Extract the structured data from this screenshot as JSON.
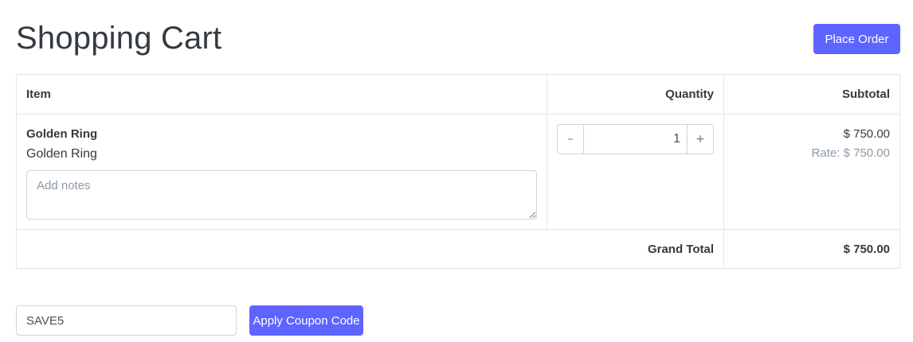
{
  "header": {
    "title": "Shopping Cart",
    "place_order_label": "Place Order"
  },
  "table": {
    "columns": {
      "item": "Item",
      "quantity": "Quantity",
      "subtotal": "Subtotal"
    },
    "items": [
      {
        "title": "Golden Ring",
        "description": "Golden Ring",
        "notes_placeholder": "Add notes",
        "notes_value": "",
        "quantity": "1",
        "decrement_glyph": "–",
        "increment_glyph": "+",
        "subtotal": "$ 750.00",
        "rate": "Rate: $ 750.00"
      }
    ],
    "grand_total_label": "Grand Total",
    "grand_total_value": "$ 750.00"
  },
  "coupon": {
    "value": "SAVE5",
    "apply_label": "Apply Coupon Code"
  },
  "colors": {
    "primary": "#5e64ff",
    "text": "#343a40",
    "muted": "#8d99a6",
    "border": "#e2e6ea"
  }
}
